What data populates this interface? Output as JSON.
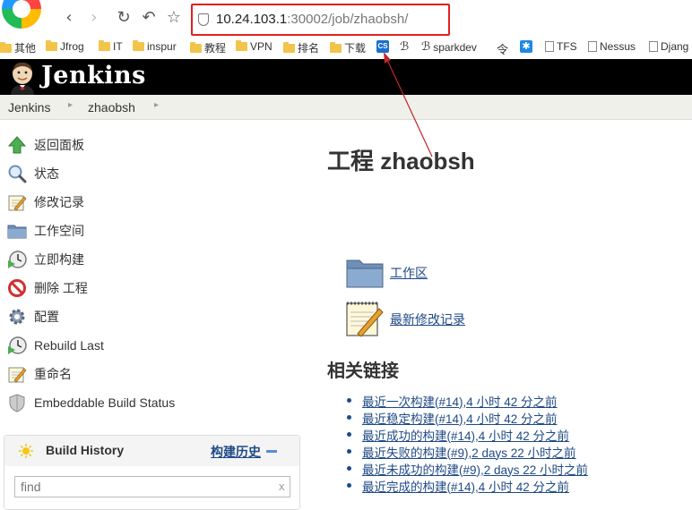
{
  "browser": {
    "url_host": "10.24.103.1",
    "url_path": ":30002/job/zhaobsh/",
    "bookmarks": [
      "其他",
      "Jfrog",
      "IT",
      "inspur",
      "教程",
      "VPN",
      "排名",
      "下载",
      "sparkdev",
      "TFS",
      "Nessus",
      "Djang"
    ],
    "accent_color": "#e02020"
  },
  "header": {
    "title": "Jenkins",
    "background": "#000000"
  },
  "breadcrumb": [
    "Jenkins",
    "zhaobsh"
  ],
  "sidebar": {
    "items": [
      {
        "label": "返回面板",
        "icon": "up-arrow-icon"
      },
      {
        "label": "状态",
        "icon": "magnifier-icon"
      },
      {
        "label": "修改记录",
        "icon": "notepad-icon"
      },
      {
        "label": "工作空间",
        "icon": "folder-icon"
      },
      {
        "label": "立即构建",
        "icon": "build-clock-icon"
      },
      {
        "label": "删除 工程",
        "icon": "no-entry-icon"
      },
      {
        "label": "配置",
        "icon": "gear-icon"
      },
      {
        "label": "Rebuild Last",
        "icon": "build-clock-icon"
      },
      {
        "label": "重命名",
        "icon": "notepad-icon"
      },
      {
        "label": "Embeddable Build Status",
        "icon": "shield-icon"
      }
    ]
  },
  "build_history": {
    "title": "Build History",
    "link": "构建历史",
    "search_placeholder": "find",
    "clear": "x"
  },
  "main": {
    "title": "工程 zhaobsh",
    "links": [
      {
        "label": "工作区",
        "icon": "folder-icon"
      },
      {
        "label": "最新修改记录",
        "icon": "notepad-icon"
      }
    ],
    "related_title": "相关链接",
    "related": [
      "最近一次构建(#14),4 小时 42 分之前",
      "最近稳定构建(#14),4 小时 42 分之前",
      "最近成功的构建(#14),4 小时 42 分之前",
      "最近失败的构建(#9),2 days 22 小时之前",
      "最近未成功的构建(#9),2 days 22 小时之前",
      "最近完成的构建(#14),4 小时 42 分之前"
    ]
  }
}
